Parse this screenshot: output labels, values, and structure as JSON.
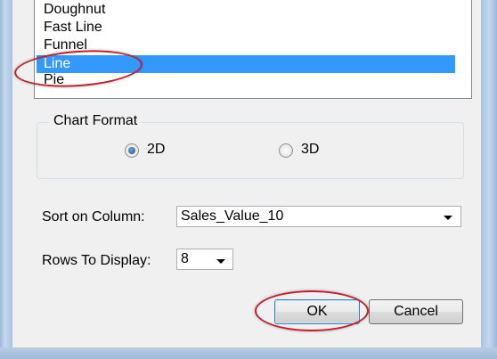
{
  "chart_type_list": {
    "items": [
      "Doughnut",
      "Fast Line",
      "Funnel",
      "Line",
      "Pie"
    ],
    "selected": "Line"
  },
  "chart_format": {
    "title": "Chart Format",
    "options": [
      {
        "label": "2D",
        "checked": true
      },
      {
        "label": "3D",
        "checked": false
      }
    ]
  },
  "sort": {
    "label": "Sort on Column:",
    "value": "Sales_Value_10"
  },
  "rows": {
    "label": "Rows To Display:",
    "value": "8"
  },
  "buttons": {
    "ok": "OK",
    "cancel": "Cancel"
  },
  "colors": {
    "selection": "#3399ff",
    "annotation": "#c0202a",
    "dialog_bg": "#f0f0f0"
  },
  "icons": {
    "scroll_down": "▼"
  }
}
